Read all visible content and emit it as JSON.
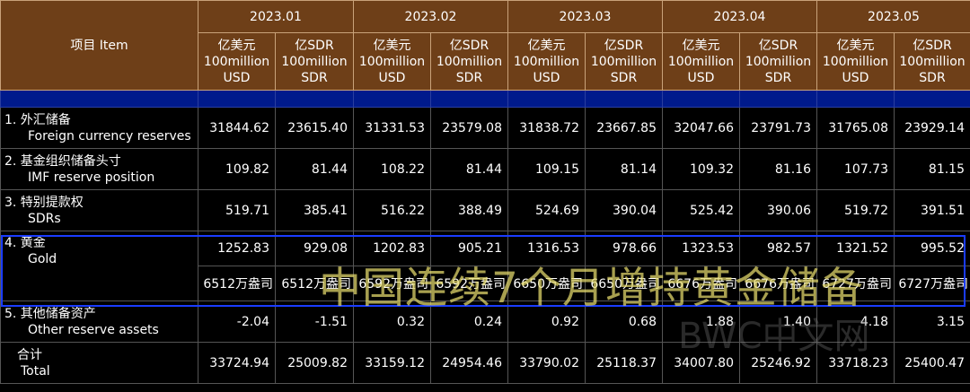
{
  "header": {
    "item_label": "项目  Item",
    "periods": [
      "2023.01",
      "2023.02",
      "2023.03",
      "2023.04",
      "2023.05"
    ],
    "unit_usd": [
      "亿美元",
      "100million",
      "USD"
    ],
    "unit_sdr": [
      "亿SDR",
      "100million",
      "SDR"
    ]
  },
  "rows": [
    {
      "zh": "1.  外汇储备",
      "en": "Foreign currency reserves",
      "values": [
        "31844.62",
        "23615.40",
        "31331.53",
        "23579.08",
        "31838.72",
        "23667.85",
        "32047.66",
        "23791.73",
        "31765.08",
        "23929.14"
      ]
    },
    {
      "zh": "2.  基金组织储备头寸",
      "en": "IMF reserve position",
      "values": [
        "109.82",
        "81.44",
        "108.22",
        "81.44",
        "109.15",
        "81.14",
        "109.32",
        "81.16",
        "107.73",
        "81.15"
      ]
    },
    {
      "zh": "3.  特别提款权",
      "en": "SDRs",
      "values": [
        "519.71",
        "385.41",
        "516.22",
        "388.49",
        "524.69",
        "390.04",
        "525.42",
        "390.06",
        "519.72",
        "391.51"
      ]
    },
    {
      "zh": "4.  黄金",
      "en": "Gold",
      "values": [
        "1252.83",
        "929.08",
        "1202.83",
        "905.21",
        "1316.53",
        "978.66",
        "1323.53",
        "982.57",
        "1321.52",
        "995.52"
      ],
      "sub_values": [
        "6512万盎司",
        "6512万盎司",
        "6592万盎司",
        "6592万盎司",
        "6650万盎司",
        "6650万盎司",
        "6676万盎司",
        "6676万盎司",
        "6727万盎司",
        "6727万盎司"
      ]
    },
    {
      "zh": "5.  其他储备资产",
      "en": "Other reserve assets",
      "values": [
        "-2.04",
        "-1.51",
        "0.32",
        "0.24",
        "0.92",
        "0.68",
        "1.88",
        "1.40",
        "4.18",
        "3.15"
      ]
    },
    {
      "zh": "合计",
      "en": "Total",
      "values": [
        "33724.94",
        "25009.82",
        "33159.12",
        "24954.46",
        "33790.02",
        "25118.37",
        "34007.80",
        "25246.92",
        "33718.23",
        "25400.47"
      ]
    }
  ],
  "overlay": {
    "caption": "中国连续7个月增持黄金储备",
    "watermark": "BWC中文网"
  },
  "colors": {
    "header_bg": "#6e3f18",
    "band": "#001a8c",
    "highlight_border": "#1a3cff",
    "caption": "#e8dc6e"
  }
}
